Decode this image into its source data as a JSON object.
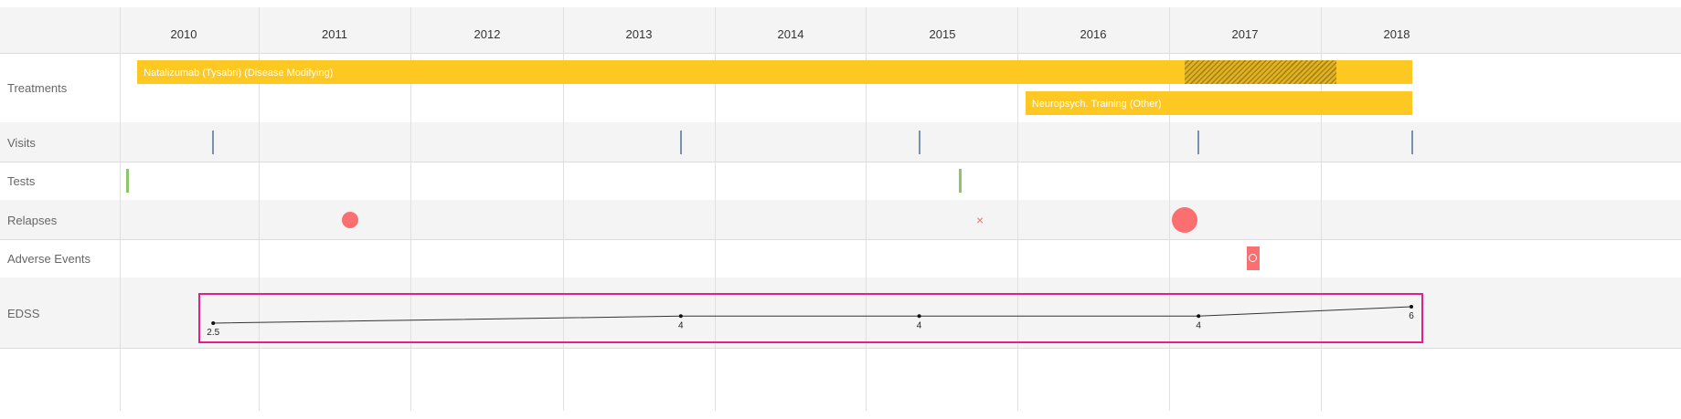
{
  "rows": [
    {
      "id": "treatments",
      "label": "Treatments"
    },
    {
      "id": "visits",
      "label": "Visits"
    },
    {
      "id": "tests",
      "label": "Tests"
    },
    {
      "id": "relapses",
      "label": "Relapses"
    },
    {
      "id": "adverse",
      "label": "Adverse Events"
    },
    {
      "id": "edss",
      "label": "EDSS"
    }
  ],
  "colors": {
    "treatment": "#fec822",
    "treatment_hatch": "#a7821a",
    "visit": "#7991ae",
    "test": "#8cc56a",
    "relapse": "#fb6f70",
    "edss_highlight": "#e61e8c",
    "edss_line": "#333333"
  },
  "chart_data": {
    "type": "timeline",
    "x_axis": {
      "unit": "year",
      "tick_labels": [
        "2010",
        "2011",
        "2012",
        "2013",
        "2014",
        "2015",
        "2016",
        "2017",
        "2018"
      ],
      "range": [
        2009.6,
        2018.1
      ]
    },
    "treatments": [
      {
        "label": "Natalizumab (Tysabri) (Disease Modifying)",
        "start": 2009.7,
        "end": 2018.1,
        "hatched": [
          2016.6,
          2017.6
        ]
      },
      {
        "label": "Neuropsych. Training (Other)",
        "start": 2015.55,
        "end": 2018.1
      }
    ],
    "visits": [
      2010.2,
      2013.28,
      2014.85,
      2016.69,
      2018.1
    ],
    "tests": [
      2009.62,
      2015.11
    ],
    "relapses": [
      {
        "x": 2011.1,
        "marker": "circle",
        "size": "medium"
      },
      {
        "x": 2015.25,
        "marker": "x",
        "size": "small"
      },
      {
        "x": 2016.6,
        "marker": "circle",
        "size": "large"
      }
    ],
    "adverse_events": [
      {
        "x": 2017.05,
        "marker": "square-circle"
      }
    ],
    "edss": {
      "x": [
        2010.2,
        2013.28,
        2014.85,
        2016.69,
        2018.1
      ],
      "y": [
        2.5,
        4,
        4,
        4,
        6
      ],
      "labels": [
        "2.5",
        "4",
        "4",
        "4",
        "6"
      ],
      "highlighted": true
    }
  }
}
